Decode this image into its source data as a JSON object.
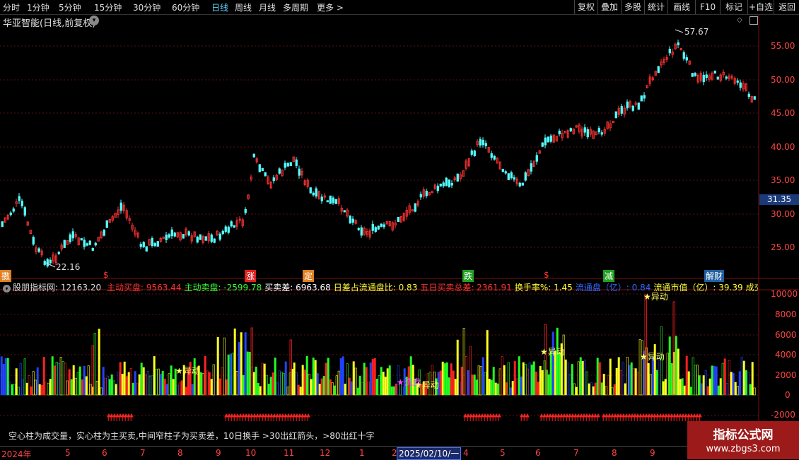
{
  "toolbar": {
    "periods": [
      "分时",
      "1分钟",
      "5分钟",
      "15分钟",
      "30分钟",
      "60分钟",
      "日线",
      "周线",
      "月线",
      "多周期",
      "更多 >"
    ],
    "active_period": "日线",
    "right_buttons": [
      "复权",
      "叠加",
      "多股",
      "统计",
      "画线",
      "F10",
      "标记",
      "+自选",
      "返回"
    ]
  },
  "stock": {
    "title": "华亚智能(日线,前复权)"
  },
  "price_chart": {
    "y_ticks": [
      "55.00",
      "50.00",
      "45.00",
      "40.00",
      "35.00",
      "30.00",
      "25.00"
    ],
    "high_label": "57.67",
    "low_label": "22.16",
    "current_price": "31.35"
  },
  "signal_labels": [
    "擞",
    "$",
    "涨",
    "定",
    "跌",
    "$",
    "减",
    "解财"
  ],
  "indicator": {
    "name": "股朋指标网",
    "value": ": 12163.20",
    "items": [
      {
        "text": "主动买盘: 9563.44",
        "color": "#ff3333"
      },
      {
        "text": "主动卖盘: -2599.78",
        "color": "#33ff33"
      },
      {
        "text": "买卖差: 6963.68",
        "color": "#ffffff"
      },
      {
        "text": "日差占流通盘比: 0.83",
        "color": "#ffff33"
      },
      {
        "text": "五日买卖总差: 2361.91",
        "color": "#ff3333"
      },
      {
        "text": "换手率%: 1.45",
        "color": "#ffff33"
      },
      {
        "text": "流通盘（亿）: 0.84",
        "color": "#3366ff"
      },
      {
        "text": "流通市值（亿）: 39.39",
        "color": "#ffff33"
      },
      {
        "text": "成交额（千万",
        "color": "#ffff33"
      }
    ],
    "y_ticks": [
      "10000",
      "8000",
      "6000",
      "4000",
      "2000",
      "0",
      "-2000"
    ],
    "annotations": [
      "★异动",
      "★异动",
      "★洗盘",
      "★异动",
      "★异动",
      "★异动"
    ],
    "footer_text": "空心柱为成交量，实心柱为主买卖,中间窄柱子为买卖差，10日换手 >30出红箭头，>80出红十字"
  },
  "timeline": {
    "labels": [
      "2024年",
      "5",
      "6",
      "7",
      "8",
      "9",
      "10",
      "11",
      "12",
      "1",
      "2",
      "2025/02/10/一",
      "4",
      "5",
      "6",
      "7",
      "8",
      "9"
    ]
  },
  "watermark": {
    "line1": "指标公式网",
    "line2": "www.zbgs3.com"
  }
}
